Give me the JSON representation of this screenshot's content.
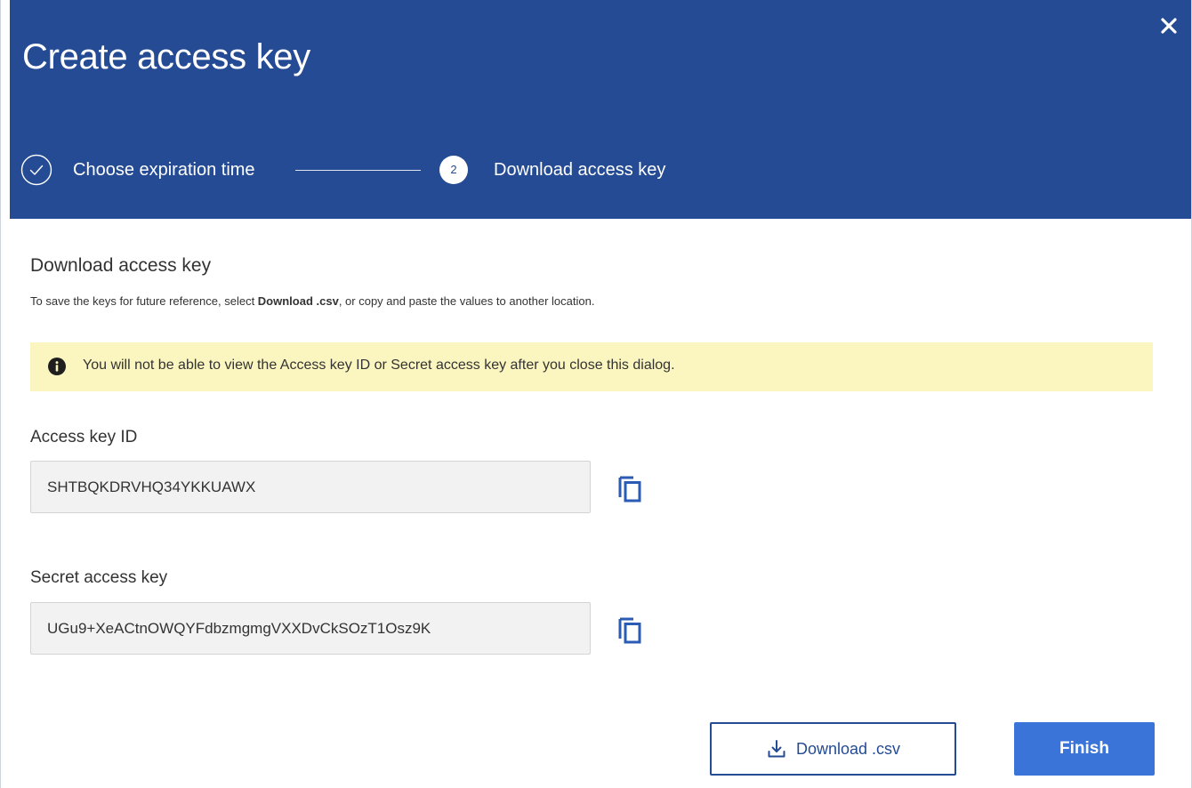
{
  "dialog": {
    "title": "Create access key",
    "close_icon": "close-icon"
  },
  "stepper": {
    "steps": [
      {
        "label": "Choose expiration time",
        "state": "completed",
        "icon": "check-circle-icon"
      },
      {
        "number": "2",
        "label": "Download access key",
        "state": "active"
      }
    ]
  },
  "content": {
    "section_title": "Download access key",
    "instructions": {
      "before": "To save the keys for future reference, select ",
      "bold": "Download .csv",
      "after": ", or copy and paste the values to another location."
    },
    "alert": {
      "icon": "info-icon",
      "text": "You will not be able to view the Access key ID or Secret access key after you close this dialog."
    },
    "access_key_id": {
      "label": "Access key ID",
      "value": "SHTBQKDRVHQ34YKKUAWX",
      "copy_icon": "copy-icon"
    },
    "secret_access_key": {
      "label": "Secret access key",
      "value": "UGu9+XeACtnOWQYFdbzmgmgVXXDvCkSOzT1Osz9K",
      "copy_icon": "copy-icon"
    }
  },
  "footer": {
    "download_label": "Download .csv",
    "download_icon": "download-icon",
    "finish_label": "Finish"
  },
  "colors": {
    "header_bg": "#244b93",
    "alert_bg": "#fbf6bf",
    "primary": "#3b74d8",
    "accent": "#244b93"
  }
}
